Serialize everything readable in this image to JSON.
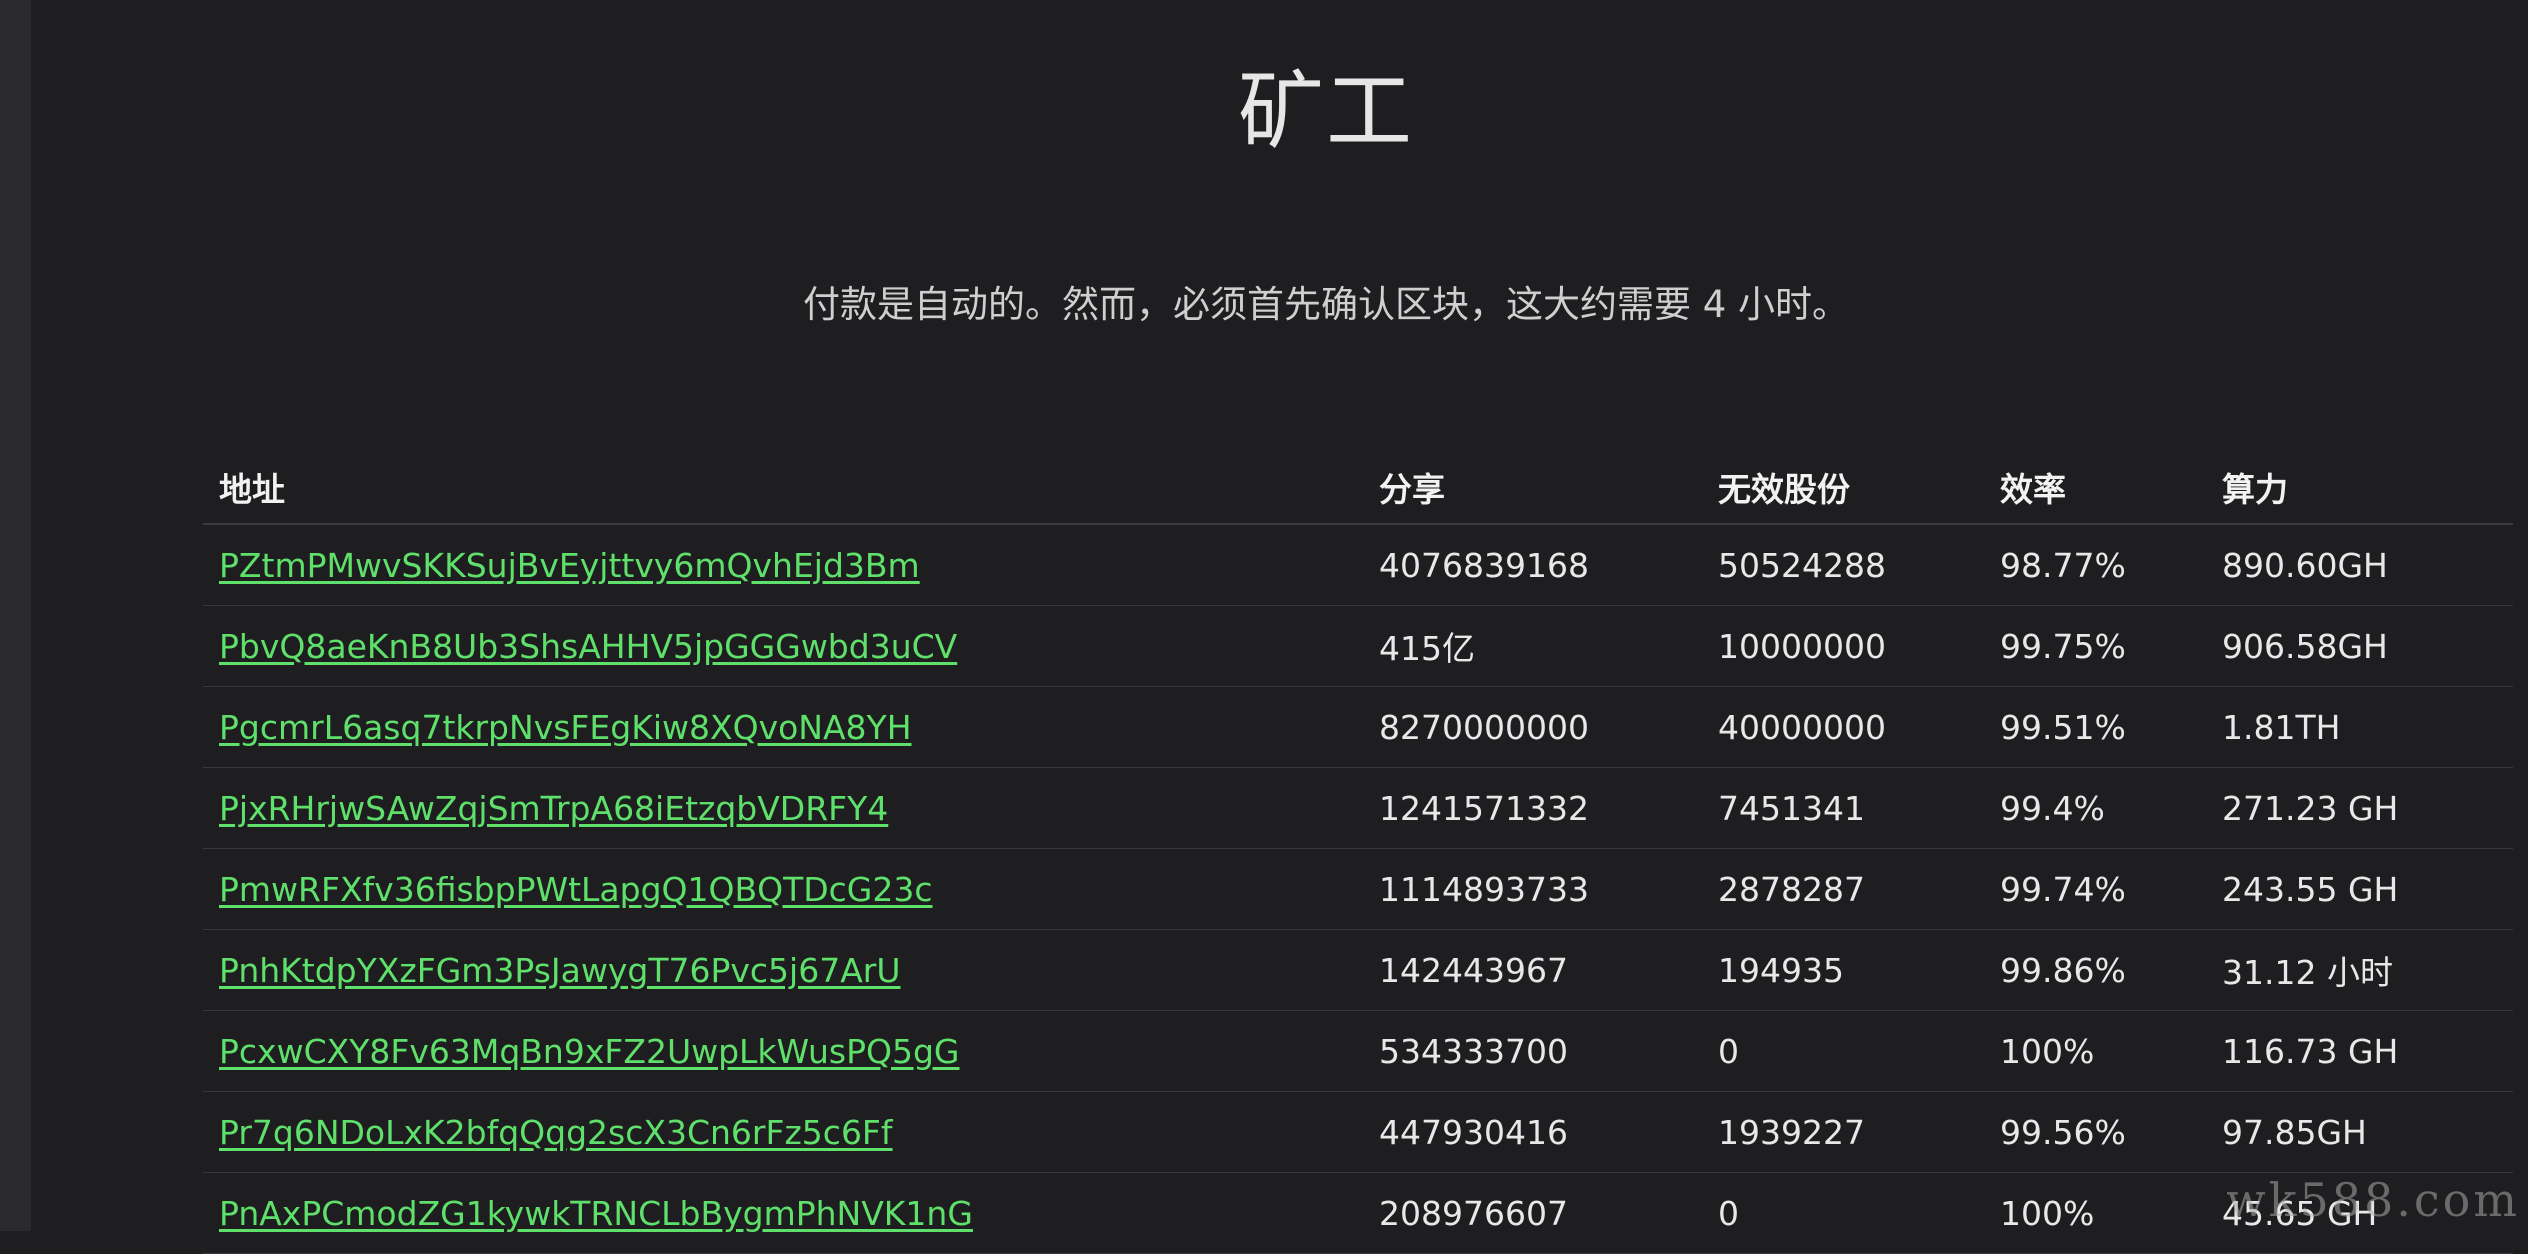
{
  "page": {
    "title": "矿工",
    "notice": "付款是自动的。然而，必须首先确认区块，这大约需要 4 小时。"
  },
  "table": {
    "headers": {
      "address": "地址",
      "shares": "分享",
      "invalid": "无效股份",
      "efficiency": "效率",
      "hashrate": "算力"
    },
    "rows": [
      {
        "address": "PZtmPMwvSKKSujBvEyjttvy6mQvhEjd3Bm",
        "shares": "4076839168",
        "invalid": "50524288",
        "efficiency": "98.77%",
        "hashrate": "890.60GH"
      },
      {
        "address": "PbvQ8aeKnB8Ub3ShsAHHV5jpGGGwbd3uCV",
        "shares": "415亿",
        "invalid": "10000000",
        "efficiency": "99.75%",
        "hashrate": "906.58GH"
      },
      {
        "address": "PgcmrL6asq7tkrpNvsFEgKiw8XQvoNA8YH",
        "shares": "8270000000",
        "invalid": "40000000",
        "efficiency": "99.51%",
        "hashrate": "1.81TH"
      },
      {
        "address": "PjxRHrjwSAwZqjSmTrpA68iEtzqbVDRFY4",
        "shares": "1241571332",
        "invalid": "7451341",
        "efficiency": "99.4%",
        "hashrate": "271.23 GH"
      },
      {
        "address": "PmwRFXfv36fisbpPWtLapgQ1QBQTDcG23c",
        "shares": "1114893733",
        "invalid": "2878287",
        "efficiency": "99.74%",
        "hashrate": "243.55 GH"
      },
      {
        "address": "PnhKtdpYXzFGm3PsJawygT76Pvc5j67ArU",
        "shares": "142443967",
        "invalid": "194935",
        "efficiency": "99.86%",
        "hashrate": "31.12 小时"
      },
      {
        "address": "PcxwCXY8Fv63MqBn9xFZ2UwpLkWusPQ5gG",
        "shares": "534333700",
        "invalid": "0",
        "efficiency": "100%",
        "hashrate": "116.73 GH"
      },
      {
        "address": "Pr7q6NDoLxK2bfqQqg2scX3Cn6rFz5c6Ff",
        "shares": "447930416",
        "invalid": "1939227",
        "efficiency": "99.56%",
        "hashrate": "97.85GH"
      },
      {
        "address": "PnAxPCmodZG1kywkTRNCLbBygmPhNVK1nG",
        "shares": "208976607",
        "invalid": "0",
        "efficiency": "100%",
        "hashrate": "45.65 GH"
      }
    ]
  },
  "watermark": "wk588.com"
}
